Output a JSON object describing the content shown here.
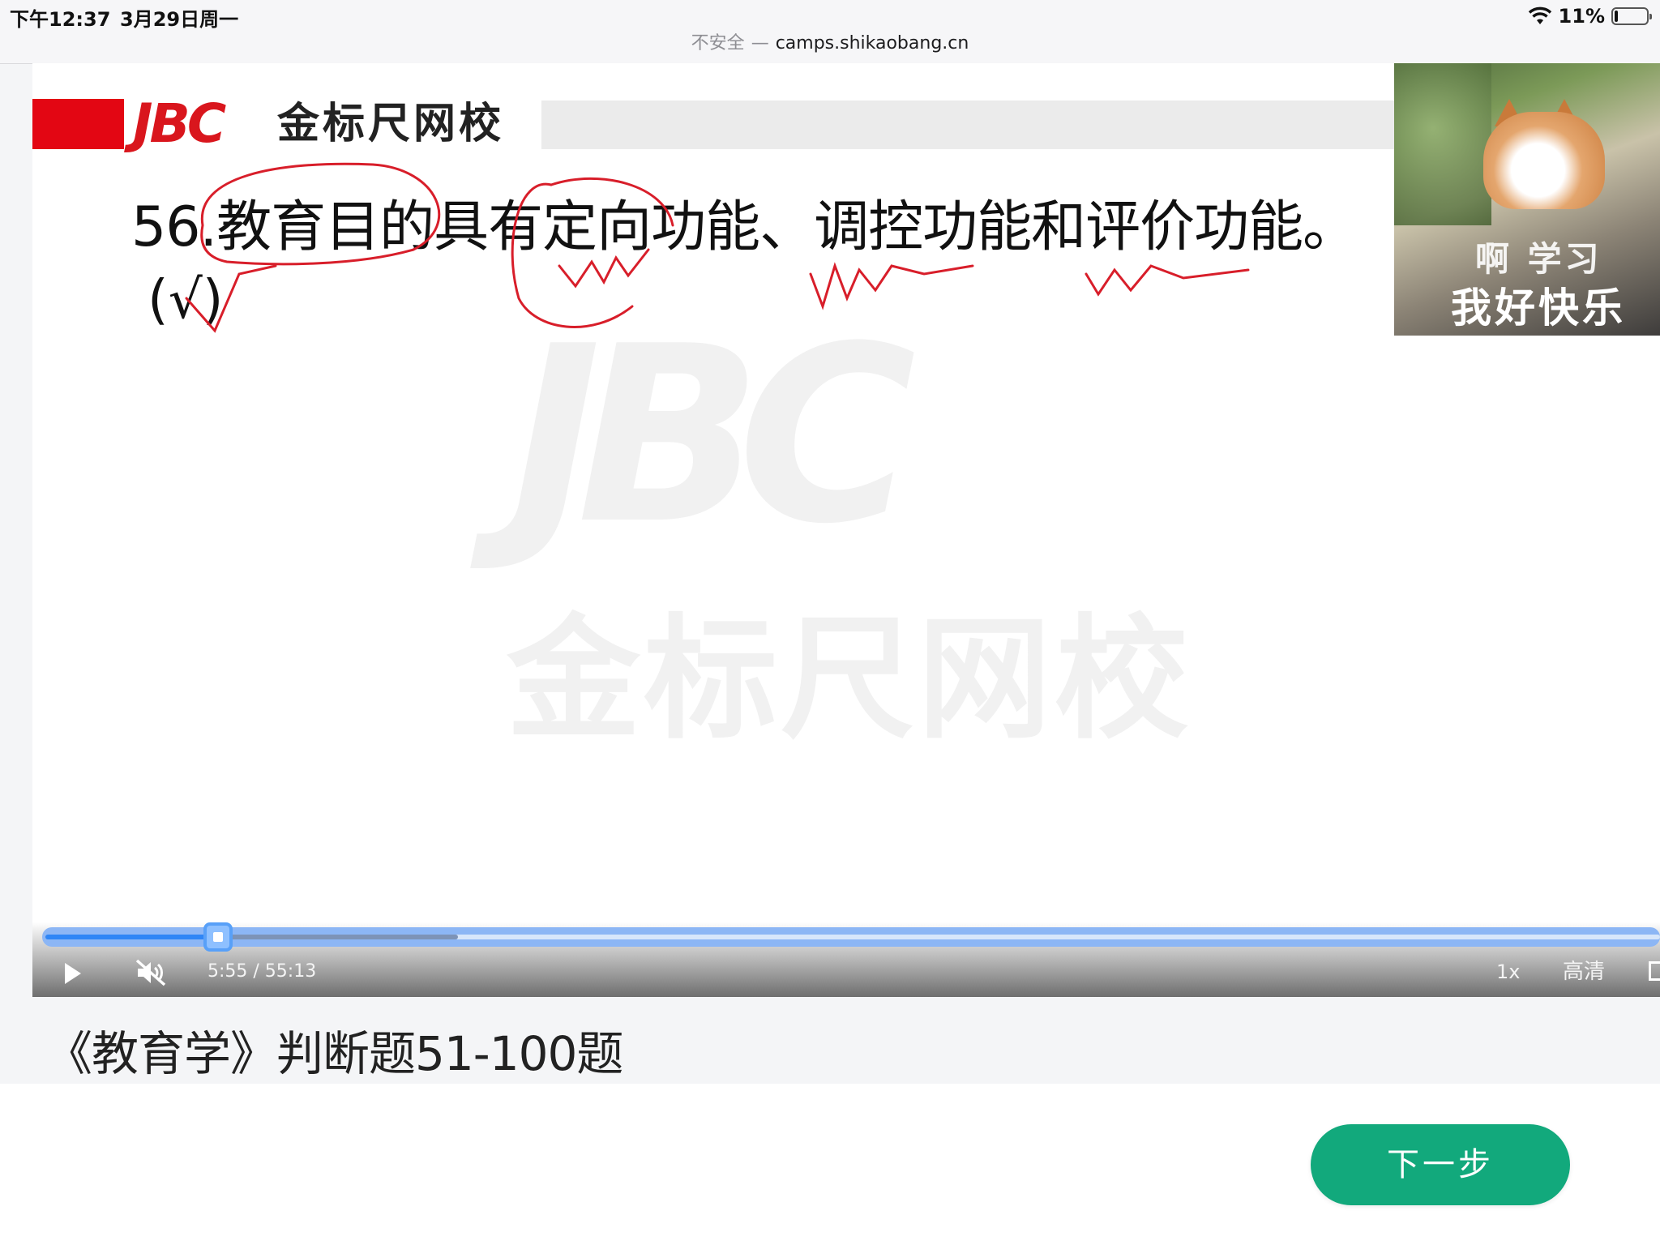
{
  "status_bar": {
    "time": "下午12:37",
    "date": "3月29日周一",
    "battery_percent": "11%",
    "battery_level": 0.11
  },
  "url_bar": {
    "insecure_label": "不安全",
    "separator": "—",
    "host": "camps.shikaobang.cn"
  },
  "video": {
    "brand_logo": "JBC",
    "brand_name": "金标尺网校",
    "watermark_logo": "JBC",
    "watermark_name": "金标尺网校",
    "question_text": "56.教育目的具有定向功能、调控功能和评价功能。",
    "answer_text": "(√)",
    "pip_caption_top": "啊 学习",
    "pip_caption_bottom": "我好快乐"
  },
  "player": {
    "current_time": "5:55",
    "duration": "55:13",
    "time_display": "5:55 / 55:13",
    "played_fraction": 0.107,
    "buffered_fraction": 0.149,
    "speed_label": "1x",
    "quality_label": "高清",
    "muted": true
  },
  "course": {
    "title": "《教育学》判断题51-100题"
  },
  "actions": {
    "next_label": "下一步"
  },
  "colors": {
    "accent_green": "#12a97c",
    "brand_red": "#e30613",
    "progress_blue": "#2f86f6"
  }
}
